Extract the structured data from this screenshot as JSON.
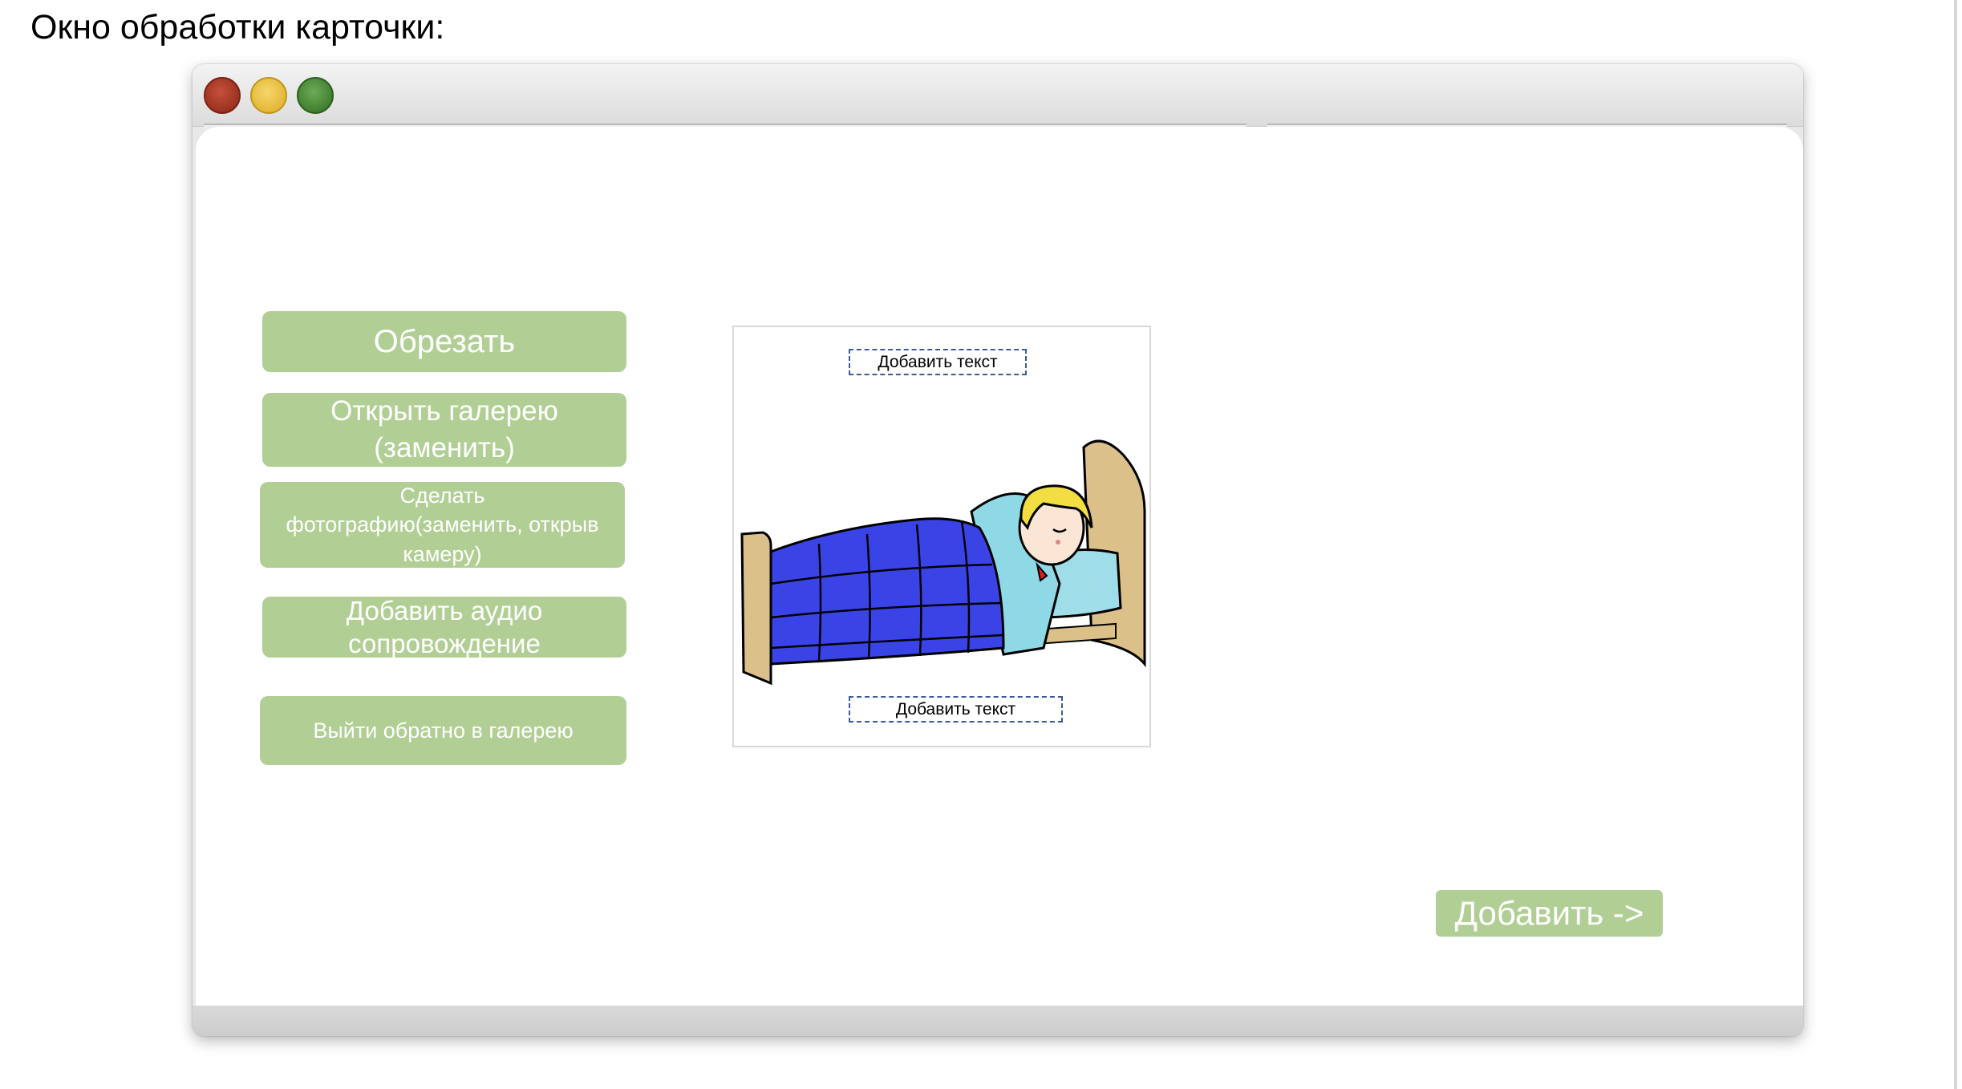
{
  "page": {
    "heading": "Окно обработки карточки:"
  },
  "window": {
    "controls": {
      "close_color": "#a63a26",
      "minimize_color": "#ecc542",
      "maximize_color": "#4f8f3c"
    }
  },
  "actions": {
    "crop_label": "Обрезать",
    "gallery_label": "Открыть галерею\n(заменить)",
    "photo_label": "Сделать\nфотографию(заменить, открыв\nкамеру)",
    "audio_label": "Добавить аудио\nсопровождение",
    "exit_label": "Выйти обратно в галерею",
    "add_label": "Добавить ->"
  },
  "card": {
    "top_text": "Добавить текст",
    "bottom_text": "Добавить текст",
    "image_icon": "sleeping-child-in-bed"
  },
  "colors": {
    "button_bg": "#b1cf95",
    "button_text": "#ffffff",
    "textbox_border": "#3d5a9a"
  }
}
